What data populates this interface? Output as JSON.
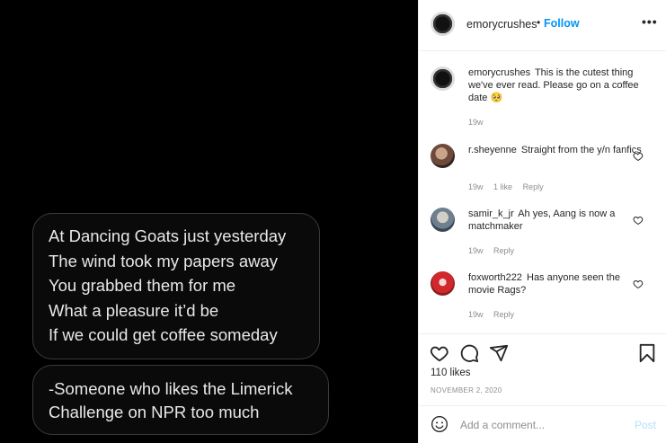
{
  "post_image": {
    "bubble1_lines": [
      "At Dancing Goats just yesterday",
      "The wind took my papers away",
      "You grabbed them for me",
      "What a pleasure it’d be",
      "If we could get coffee someday"
    ],
    "bubble2_lines": [
      "-Someone who likes the Limerick",
      "Challenge on NPR too much"
    ]
  },
  "header": {
    "username": "emorycrushes",
    "separator": "•",
    "follow_label": "Follow",
    "more_label": "•••"
  },
  "comments": [
    {
      "username": "emorycrushes",
      "text": "This is the cutest thing we've ever read. Please go on a coffee date 🥺",
      "time": "19w",
      "likes": "",
      "reply": ""
    },
    {
      "username": "r.sheyenne",
      "text": "Straight from the y/n fanfics",
      "time": "19w",
      "likes": "1 like",
      "reply": "Reply"
    },
    {
      "username": "samir_k_jr",
      "text": "Ah yes, Aang is now a matchmaker",
      "time": "19w",
      "likes": "",
      "reply": "Reply"
    },
    {
      "username": "foxworth222",
      "text": "Has anyone seen the movie Rags?",
      "time": "19w",
      "likes": "",
      "reply": "Reply"
    }
  ],
  "actions": {
    "likes_count": "110 likes",
    "date": "NOVEMBER 2, 2020"
  },
  "add_comment": {
    "placeholder": "Add a comment...",
    "post_label": "Post"
  },
  "icons": [
    "heart-icon",
    "comment-icon",
    "share-icon",
    "bookmark-icon",
    "emoji-icon",
    "more-icon"
  ],
  "colors": {
    "link_blue": "#0095f6",
    "post_disabled": "#b2dffc",
    "meta_gray": "#8e8e8e",
    "media_background": "#000000"
  }
}
